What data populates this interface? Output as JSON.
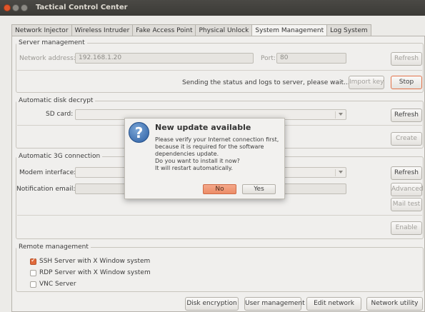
{
  "window": {
    "title": "Tactical Control Center"
  },
  "tabs": [
    "Network Injector",
    "Wireless Intruder",
    "Fake Access Point",
    "Physical Unlock",
    "System Management",
    "Log System"
  ],
  "active_tab": "System Management",
  "server": {
    "legend": "Server management",
    "address_label": "Network address:",
    "address_value": "192.168.1.20",
    "port_label": "Port:",
    "port_value": "80",
    "refresh": "Refresh",
    "status": "Sending the status and logs to server, please wait...",
    "import_key": "Import key",
    "stop": "Stop"
  },
  "disk": {
    "legend": "Automatic disk decrypt",
    "sd_label": "SD card:",
    "refresh": "Refresh",
    "create": "Create"
  },
  "g3": {
    "legend": "Automatic 3G connection",
    "modem_label": "Modem interface:",
    "email_label": "Notification email:",
    "refresh": "Refresh",
    "advanced": "Advanced",
    "mail_test": "Mail test",
    "enable": "Enable"
  },
  "remote": {
    "legend": "Remote management",
    "options": [
      {
        "label": "SSH Server with X Window system",
        "checked": true
      },
      {
        "label": "RDP Server with X Window system",
        "checked": false
      },
      {
        "label": "VNC Server",
        "checked": false
      }
    ]
  },
  "bottom_buttons": [
    "Disk encryption",
    "User management",
    "Edit network",
    "Network utility"
  ],
  "dialog": {
    "title": "New update available",
    "lines": [
      "Please verify your Internet connection first,",
      "because it is required for the software",
      "dependencies update.",
      "Do you want to install it now?",
      "It will restart automatically."
    ],
    "no": "No",
    "yes": "Yes",
    "icon": "question-icon"
  },
  "colors": {
    "accent": "#e06a3c",
    "titlebar": "#3b3a36"
  }
}
